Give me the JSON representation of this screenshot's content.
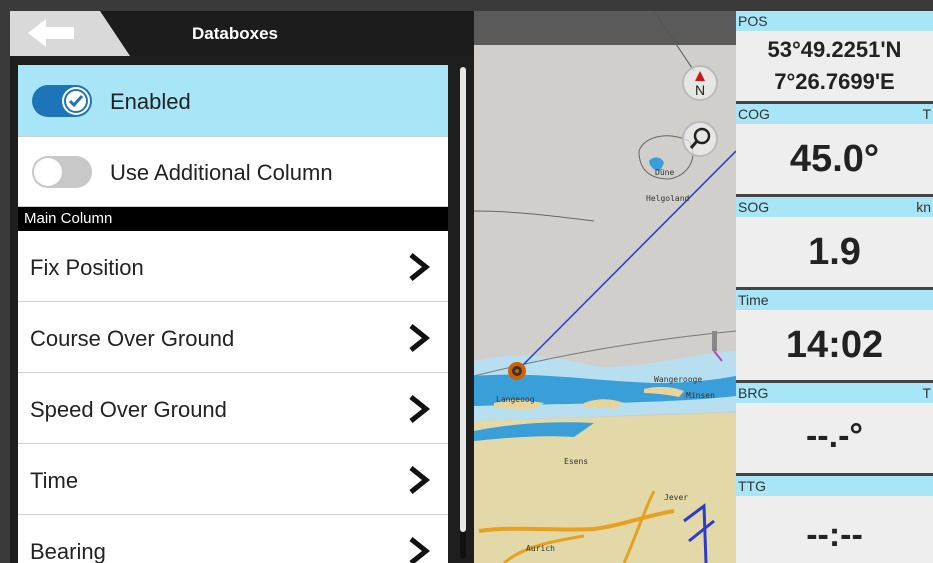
{
  "header": {
    "title": "Databoxes",
    "back_icon": "arrow-left-icon"
  },
  "settings": {
    "enabled_label": "Enabled",
    "enabled_state": true,
    "additional_column_label": "Use Additional Column",
    "additional_column_state": false,
    "section_header": "Main Column",
    "items": [
      {
        "label": "Fix Position"
      },
      {
        "label": "Course Over Ground"
      },
      {
        "label": "Speed Over Ground"
      },
      {
        "label": "Time"
      },
      {
        "label": "Bearing"
      }
    ]
  },
  "map": {
    "labels": [
      "Düne",
      "Helgoland",
      "Langeoog",
      "Wangerooge",
      "Minsen",
      "Esens",
      "Jever",
      "Aurich"
    ],
    "north_label": "N",
    "north_icon": "compass-north-icon",
    "search_icon": "magnifier-icon"
  },
  "databoxes": [
    {
      "name": "POS",
      "unit": "",
      "lines": [
        "53°49.2251'N",
        "7°26.7699'E"
      ]
    },
    {
      "name": "COG",
      "unit": "T",
      "lines": [
        "45.0°"
      ]
    },
    {
      "name": "SOG",
      "unit": "kn",
      "lines": [
        "1.9"
      ]
    },
    {
      "name": "Time",
      "unit": "",
      "lines": [
        "14:02"
      ]
    },
    {
      "name": "BRG",
      "unit": "T",
      "lines": [
        "--.-°"
      ]
    },
    {
      "name": "TTG",
      "unit": "",
      "lines": [
        "--:--"
      ]
    }
  ],
  "colors": {
    "accent": "#a8e6f7",
    "toggle_on": "#1e74b8",
    "route": "#2a3cc8"
  }
}
